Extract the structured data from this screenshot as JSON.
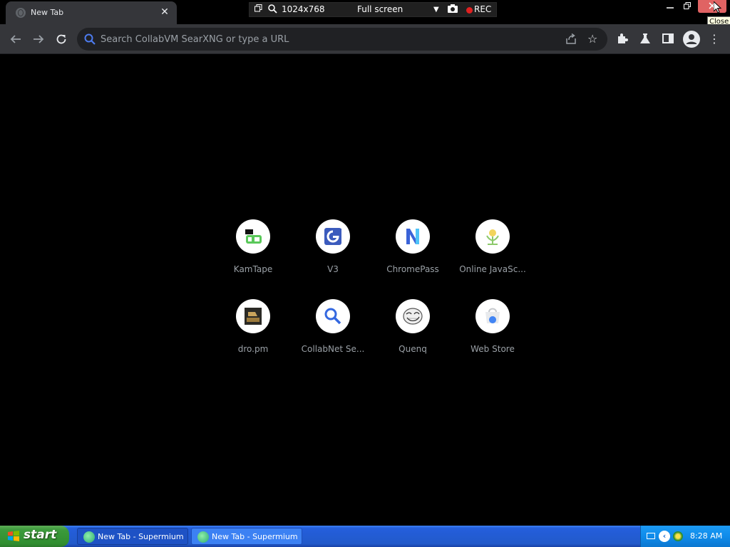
{
  "browser": {
    "tab": {
      "title": "New Tab"
    },
    "omnibox": {
      "placeholder": "Search CollabVM SearXNG or type a URL"
    }
  },
  "recorder": {
    "resolution": "1024x768",
    "mode": "Full screen",
    "rec_label": "REC"
  },
  "window": {
    "close_tooltip": "Close"
  },
  "shortcuts": [
    {
      "label": "KamTape"
    },
    {
      "label": "V3"
    },
    {
      "label": "ChromePass"
    },
    {
      "label": "Online JavaSc..."
    },
    {
      "label": "dro.pm"
    },
    {
      "label": "CollabNet Se..."
    },
    {
      "label": "Quenq"
    },
    {
      "label": "Web Store"
    }
  ],
  "taskbar": {
    "start_label": "start",
    "tasks": [
      {
        "label": "New Tab - Supermium"
      },
      {
        "label": "New Tab - Supermium"
      }
    ],
    "clock": "8:28 AM"
  },
  "colors": {
    "page_bg": "#000000",
    "toolbar_bg": "#35363a",
    "omnibox_bg": "#202124",
    "tile_label": "#9aa0a6",
    "close_hover": "#e06363",
    "xp_blue": "#245edc",
    "xp_green": "#3c9b3c"
  }
}
